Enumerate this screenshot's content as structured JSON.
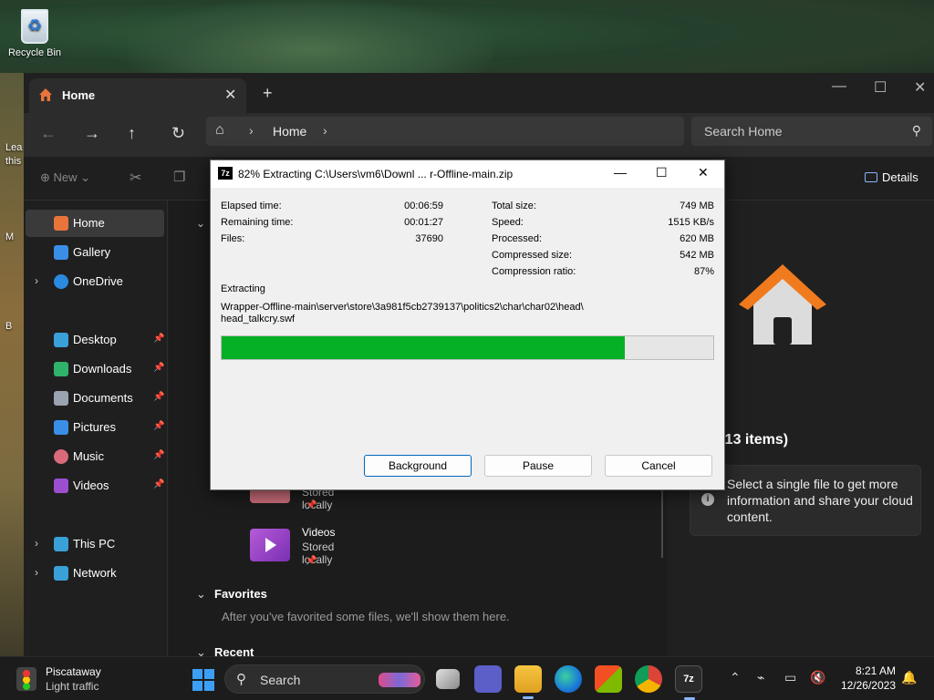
{
  "desktop": {
    "recycle_bin_label": "Recycle Bin",
    "peek_texts": [
      "Lea",
      "this",
      "M",
      "B"
    ]
  },
  "explorer": {
    "tab_title": "Home",
    "address_text": "Home",
    "search_placeholder": "Search Home",
    "command_bar": {
      "new_label": "New",
      "details_label": "Details"
    },
    "sidebar": {
      "items": [
        {
          "label": "Home",
          "icon": "home-icon",
          "color": "#e8743b",
          "selected": true
        },
        {
          "label": "Gallery",
          "icon": "gallery-icon",
          "color": "#3a8ee6"
        },
        {
          "label": "OneDrive",
          "icon": "onedrive-icon",
          "color": "#2a8ae0"
        },
        {
          "label": "Desktop",
          "icon": "desktop-icon",
          "color": "#3aa0d8"
        },
        {
          "label": "Downloads",
          "icon": "downloads-icon",
          "color": "#2fb36a"
        },
        {
          "label": "Documents",
          "icon": "documents-icon",
          "color": "#9aa3b0"
        },
        {
          "label": "Pictures",
          "icon": "pictures-icon",
          "color": "#3a8ee6"
        },
        {
          "label": "Music",
          "icon": "music-icon",
          "color": "#d86a7a"
        },
        {
          "label": "Videos",
          "icon": "videos-icon",
          "color": "#9b4fd0"
        },
        {
          "label": "This PC",
          "icon": "this-pc-icon",
          "color": "#3aa0d8"
        },
        {
          "label": "Network",
          "icon": "network-icon",
          "color": "#3aa0d8"
        }
      ]
    },
    "content": {
      "music_sub": "Stored locally",
      "videos_title": "Videos",
      "videos_sub": "Stored locally",
      "favorites_header": "Favorites",
      "favorites_message": "After you've favorited some files, we'll show them here.",
      "recent_header": "Recent"
    },
    "details_pane": {
      "title_fragment": "e (13 items)",
      "info_text": "Select a single file to get more information and share your cloud content."
    }
  },
  "dialog": {
    "title": "82% Extracting C:\\Users\\vm6\\Downl ... r-Offline-main.zip",
    "left_stats": [
      {
        "label": "Elapsed time:",
        "value": "00:06:59"
      },
      {
        "label": "Remaining time:",
        "value": "00:01:27"
      },
      {
        "label": "Files:",
        "value": "37690"
      }
    ],
    "right_stats": [
      {
        "label": "Total size:",
        "value": "749 MB"
      },
      {
        "label": "Speed:",
        "value": "1515 KB/s"
      },
      {
        "label": "Processed:",
        "value": "620 MB"
      },
      {
        "label": "Compressed size:",
        "value": "542 MB"
      },
      {
        "label": "Compression ratio:",
        "value": "87%"
      }
    ],
    "extracting_label": "Extracting",
    "current_path_line1": "Wrapper-Offline-main\\server\\store\\3a981f5cb2739137\\politics2\\char\\char02\\head\\",
    "current_path_line2": "head_talkcry.swf",
    "progress_fraction": 0.82,
    "progress_color": "#06b025",
    "buttons": {
      "background": "Background",
      "pause": "Pause",
      "cancel": "Cancel"
    }
  },
  "taskbar": {
    "weather_location": "Piscataway",
    "weather_status": "Light traffic",
    "search_label": "Search",
    "apps": [
      "task-view-icon",
      "meet-icon",
      "file-explorer-icon",
      "edge-icon",
      "store-icon",
      "chrome-icon",
      "7zip-icon"
    ],
    "time": "8:21 AM",
    "date": "12/26/2023"
  }
}
